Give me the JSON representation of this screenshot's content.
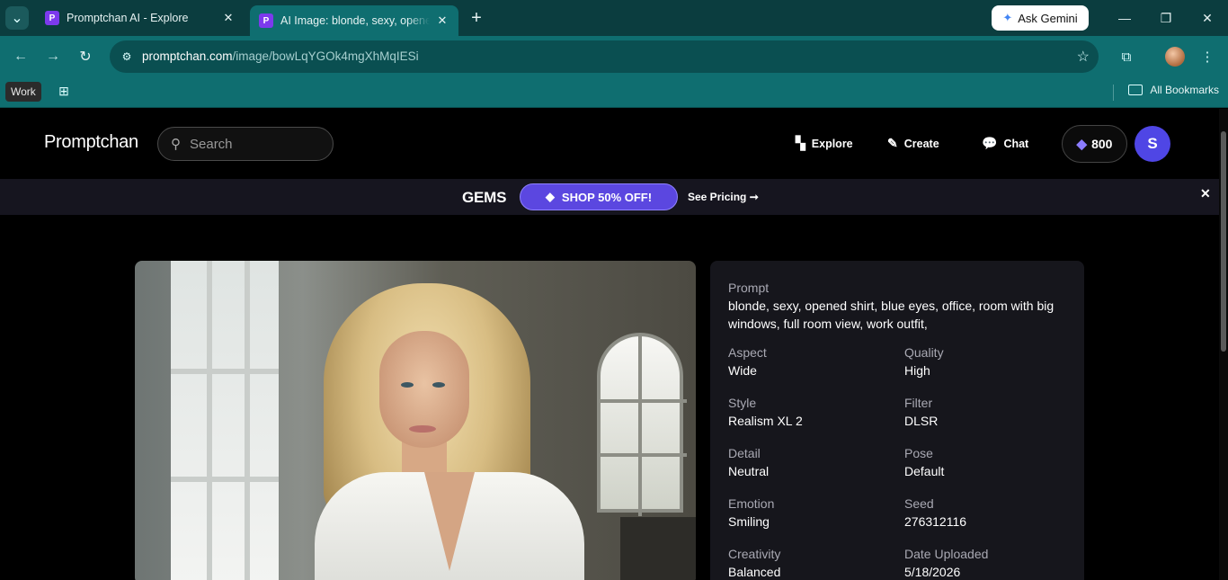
{
  "browser": {
    "tabs": [
      {
        "title": "Promptchan AI - Explore",
        "favicon": "P"
      },
      {
        "title": "AI Image: blonde, sexy, opened shirt",
        "favicon": "P"
      }
    ],
    "ask_gemini": "Ask Gemini",
    "url_host": "promptchan.com",
    "url_path": "/image/bowLqYGOk4mgXhMqIESi",
    "bookmarks": {
      "work": "Work",
      "all": "All Bookmarks"
    }
  },
  "header": {
    "logo": "Promptchan",
    "search_placeholder": "Search",
    "nav": {
      "explore": "Explore",
      "create": "Create",
      "chat": "Chat"
    },
    "gems": "800",
    "avatar_initial": "S"
  },
  "promo": {
    "gems_word": "GEMS",
    "shop": "SHOP 50% OFF!",
    "pricing": "See Pricing ➞"
  },
  "details": {
    "prompt_label": "Prompt",
    "prompt": "blonde, sexy, opened shirt, blue eyes, office, room with big windows, full room view, work outfit,",
    "fields": [
      {
        "label": "Aspect",
        "value": "Wide"
      },
      {
        "label": "Quality",
        "value": "High"
      },
      {
        "label": "Style",
        "value": "Realism XL 2"
      },
      {
        "label": "Filter",
        "value": "DLSR"
      },
      {
        "label": "Detail",
        "value": "Neutral"
      },
      {
        "label": "Pose",
        "value": "Default"
      },
      {
        "label": "Emotion",
        "value": "Smiling"
      },
      {
        "label": "Seed",
        "value": "276312116"
      },
      {
        "label": "Creativity",
        "value": "Balanced"
      },
      {
        "label": "Date Uploaded",
        "value": "5/18/2026"
      }
    ]
  }
}
